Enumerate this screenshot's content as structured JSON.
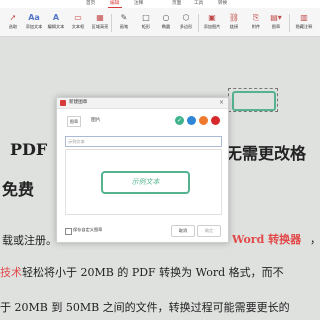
{
  "menu": {
    "items": [
      "首页",
      "编辑",
      "注释",
      "页面",
      "工具",
      "转换"
    ],
    "active_index": 1,
    "accent": "#d83b3b"
  },
  "toolbar": {
    "buttons": [
      {
        "icon": "cursor-icon",
        "label": "选取"
      },
      {
        "icon": "add-text-icon",
        "label": "添加文本"
      },
      {
        "icon": "text-edit-icon",
        "label": "编辑文本"
      },
      {
        "icon": "textbox-icon",
        "label": "文本框"
      },
      {
        "icon": "area-highlight-icon",
        "label": "区域高亮"
      },
      {
        "icon": "pencil-icon",
        "label": "画笔"
      },
      {
        "icon": "rectangle-icon",
        "label": "矩形"
      },
      {
        "icon": "ellipse-icon",
        "label": "椭圆"
      },
      {
        "icon": "polygon-icon",
        "label": "多边形"
      },
      {
        "icon": "image-icon",
        "label": "添加图片"
      },
      {
        "icon": "link-icon",
        "label": "链接"
      },
      {
        "icon": "attachment-icon",
        "label": "附件"
      },
      {
        "icon": "stamp-icon",
        "label": "图章"
      },
      {
        "icon": "hide-icon",
        "label": "隐藏注释"
      }
    ]
  },
  "document": {
    "line1_left": "PDF",
    "line1_right": "无需更改格",
    "line2": "免费",
    "line3_left": "载或注册。",
    "line3_right": "Word 转换器",
    "line3_tail": "，",
    "line4_red": "技术",
    "line4_rest": "轻松将小于 20MB 的 PDF 转换为 Word 格式，而不",
    "line5": "于 20MB 到 50MB 之间的文件，转换过程可能需要更长的"
  },
  "dialog": {
    "title": "新建图章",
    "close": "×",
    "stamp_icon_text": "图章",
    "stamp_type_label": "图片",
    "colors": [
      "#3fb38a",
      "#2f86d6",
      "#ef7a2e",
      "#d62a2a"
    ],
    "selected_color_index": 0,
    "check": "✓",
    "input_placeholder": "示例文本",
    "preview_text": "示例文本",
    "save_default_label": "保存自定义图章",
    "cancel_label": "取消",
    "confirm_label": "确定"
  }
}
